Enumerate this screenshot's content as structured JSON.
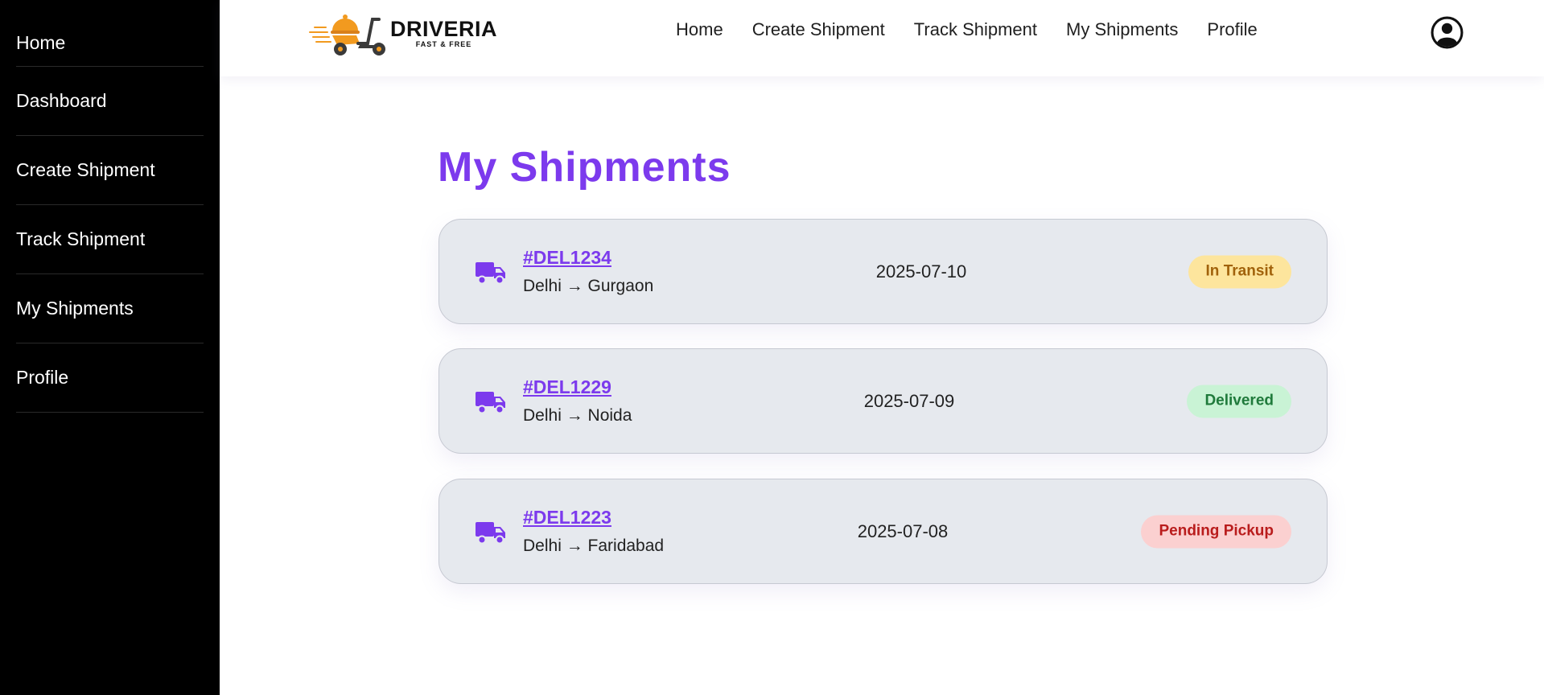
{
  "sidebar": {
    "items": [
      {
        "label": "Home"
      },
      {
        "label": "Dashboard"
      },
      {
        "label": "Create Shipment"
      },
      {
        "label": "Track Shipment"
      },
      {
        "label": "My Shipments"
      },
      {
        "label": "Profile"
      }
    ]
  },
  "header": {
    "logo_name": "DRIVERIA",
    "logo_tagline": "FAST & FREE",
    "nav": [
      {
        "label": "Home"
      },
      {
        "label": "Create Shipment"
      },
      {
        "label": "Track Shipment"
      },
      {
        "label": "My Shipments"
      },
      {
        "label": "Profile"
      }
    ],
    "avatar_icon": "user-circle-icon"
  },
  "main": {
    "title": "My Shipments",
    "shipments": [
      {
        "id": "#DEL1234",
        "route": "Delhi → Gurgaon",
        "date": "2025-07-10",
        "status": "In Transit",
        "icon": "truck-icon"
      },
      {
        "id": "#DEL1229",
        "route": "Delhi → Noida",
        "date": "2025-07-09",
        "status": "Delivered",
        "icon": "truck-icon"
      },
      {
        "id": "#DEL1223",
        "route": "Delhi → Faridabad",
        "date": "2025-07-08",
        "status": "Pending Pickup",
        "icon": "truck-icon"
      }
    ]
  },
  "colors": {
    "accent": "#7c3aed",
    "logo_orange": "#f29a1f",
    "status_in_transit_bg": "#fde59d",
    "status_in_transit_text": "#a1620b",
    "status_delivered_bg": "#c9f3d5",
    "status_delivered_text": "#1f7a3b",
    "status_pending_bg": "#fbd0d0",
    "status_pending_text": "#b91c1c"
  }
}
